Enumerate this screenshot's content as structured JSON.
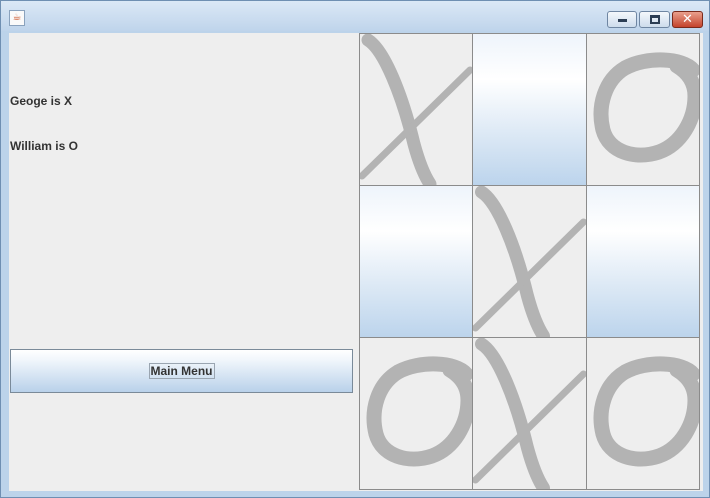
{
  "window": {
    "app_icon": "java-icon",
    "controls": {
      "minimize": "minimize-icon",
      "maximize": "maximize-icon",
      "close": "close-icon",
      "close_glyph": "✕"
    }
  },
  "players": {
    "x_label": "Geoge is X",
    "o_label": "William is O"
  },
  "menu": {
    "main_menu_label": "Main Menu"
  },
  "board": {
    "cells": [
      {
        "mark": "X"
      },
      {
        "mark": ""
      },
      {
        "mark": "O"
      },
      {
        "mark": ""
      },
      {
        "mark": "X"
      },
      {
        "mark": ""
      },
      {
        "mark": "O"
      },
      {
        "mark": "X"
      },
      {
        "mark": "O"
      }
    ]
  },
  "colors": {
    "mark": "#b3b3b3",
    "empty_cell_top": "#ffffff",
    "empty_cell_bottom": "#bcd4ec",
    "panel": "#eeeeee"
  }
}
